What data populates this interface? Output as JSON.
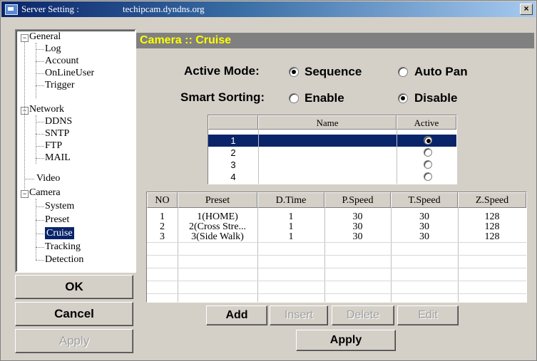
{
  "window": {
    "title": "Server Setting :",
    "host": "techipcam.dyndns.org",
    "close_label": "×"
  },
  "tree": {
    "groups": [
      {
        "label": "General",
        "expander": "−",
        "children": [
          "Log",
          "Account",
          "OnLineUser",
          "Trigger"
        ]
      },
      {
        "label": "Network",
        "expander": "−",
        "children": [
          "DDNS",
          "SNTP",
          "FTP",
          "MAIL"
        ]
      },
      {
        "label": "Video"
      },
      {
        "label": "Camera",
        "expander": "−",
        "children": [
          "System",
          "Preset",
          "Cruise",
          "Tracking",
          "Detection"
        ]
      }
    ],
    "selected": "Cruise"
  },
  "left_buttons": {
    "ok": "OK",
    "cancel": "Cancel",
    "apply": "Apply"
  },
  "panel": {
    "header": "Camera :: Cruise",
    "active_mode_label": "Active Mode:",
    "active_mode_options": [
      "Sequence",
      "Auto Pan"
    ],
    "active_mode_selected": "Sequence",
    "smart_sorting_label": "Smart Sorting:",
    "smart_sorting_options": [
      "Enable",
      "Disable"
    ],
    "smart_sorting_selected": "Disable"
  },
  "cruise_table": {
    "headers": [
      "",
      "Name",
      "Active"
    ],
    "rows": [
      {
        "no": "1",
        "name": "",
        "active": true,
        "selected": true
      },
      {
        "no": "2",
        "name": "",
        "active": false
      },
      {
        "no": "3",
        "name": "",
        "active": false
      },
      {
        "no": "4",
        "name": "",
        "active": false
      }
    ]
  },
  "preset_table": {
    "headers": [
      "NO",
      "Preset",
      "D.Time",
      "P.Speed",
      "T.Speed",
      "Z.Speed"
    ],
    "rows": [
      [
        "1",
        "1(HOME)",
        "1",
        "30",
        "30",
        "128"
      ],
      [
        "2",
        "2(Cross Stre...",
        "1",
        "30",
        "30",
        "128"
      ],
      [
        "3",
        "3(Side Walk)",
        "1",
        "30",
        "30",
        "128"
      ]
    ]
  },
  "table_buttons": {
    "add": "Add",
    "insert": "Insert",
    "delete": "Delete",
    "edit": "Edit",
    "apply": "Apply"
  }
}
